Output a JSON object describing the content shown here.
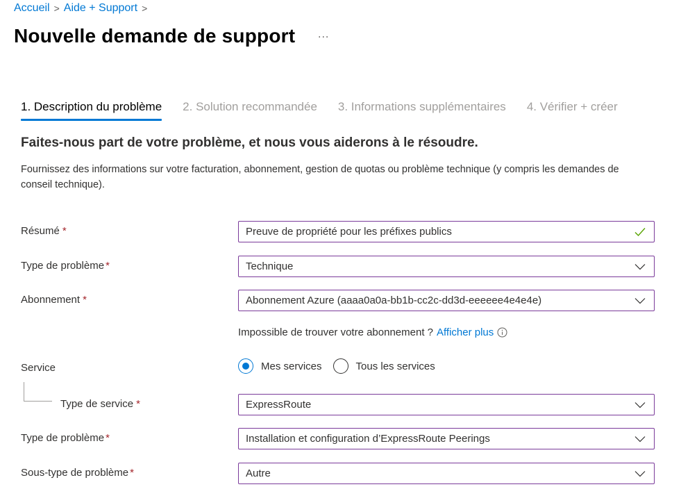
{
  "breadcrumb": {
    "items": [
      "Accueil",
      "Aide + Support"
    ]
  },
  "header": {
    "title": "Nouvelle demande de support",
    "more_label": "···"
  },
  "tabs": [
    {
      "label": "1. Description du problème",
      "active": true
    },
    {
      "label": "2. Solution recommandée",
      "active": false
    },
    {
      "label": "3. Informations supplémentaires",
      "active": false
    },
    {
      "label": "4. Vérifier + créer",
      "active": false
    }
  ],
  "section": {
    "title": "Faites-nous part de votre problème, et nous vous aiderons à le résoudre.",
    "description": "Fournissez des informations sur votre facturation, abonnement, gestion de quotas ou problème technique (y compris les demandes de conseil technique)."
  },
  "form": {
    "required_marker": "*",
    "summary": {
      "label": "Résumé",
      "value": "Preuve de propriété pour les préfixes publics",
      "valid_icon": "check-icon"
    },
    "issue_type": {
      "label": "Type de problème",
      "value": "Technique"
    },
    "subscription": {
      "label": "Abonnement",
      "value": "Abonnement Azure (aaaa0a0a-bb1b-cc2c-dd3d-eeeeee4e4e4e)"
    },
    "subscription_hint": {
      "text": "Impossible de trouver votre abonnement ?",
      "link": "Afficher plus",
      "icon": "info-icon"
    },
    "service": {
      "label": "Service",
      "options": [
        {
          "label": "Mes services",
          "checked": true
        },
        {
          "label": "Tous les services",
          "checked": false
        }
      ]
    },
    "service_type": {
      "label": "Type de service",
      "value": "ExpressRoute"
    },
    "problem_type": {
      "label": "Type de problème",
      "value": "Installation et configuration d’ExpressRoute Peerings"
    },
    "problem_subtype": {
      "label": "Sous-type de problème",
      "value": "Autre"
    }
  },
  "colors": {
    "accent": "#0078d4",
    "field_border": "#7a3a9a",
    "required": "#a4262c",
    "valid": "#57a300"
  }
}
